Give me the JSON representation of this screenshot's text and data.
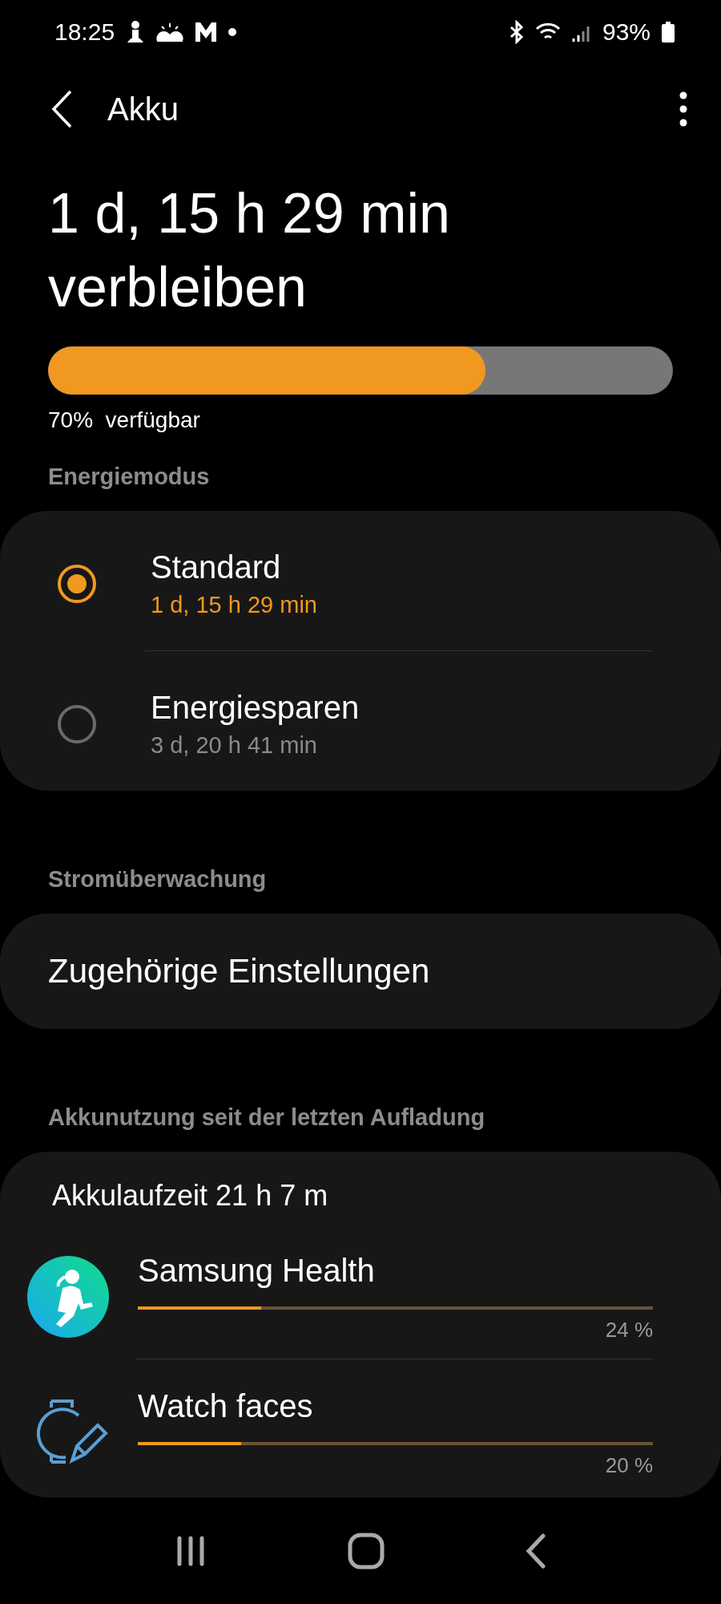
{
  "status_bar": {
    "time": "18:25",
    "battery": "93%"
  },
  "header": {
    "title": "Akku"
  },
  "remaining": {
    "title": "1 d, 15 h 29 min verbleiben",
    "level": 0.7,
    "caption": "70%  verfügbar"
  },
  "power_mode": {
    "heading": "Energiemodus",
    "options": [
      {
        "label": "Standard",
        "time": "1 d, 15 h 29 min",
        "selected": true
      },
      {
        "label": "Energiesparen",
        "time": "3 d, 20 h 41 min",
        "selected": false
      }
    ]
  },
  "monitoring": {
    "heading": "Stromüberwachung",
    "item": "Zugehörige Einstellungen"
  },
  "usage": {
    "heading": "Akkunutzung seit der letzten Aufladung",
    "uptime": "Akkulaufzeit 21 h 7 m",
    "apps": [
      {
        "kind": "health",
        "name": "Samsung Health",
        "level": 0.24,
        "percent": "24 %"
      },
      {
        "kind": "watch",
        "name": "Watch faces",
        "level": 0.2,
        "percent": "20 %"
      }
    ]
  }
}
